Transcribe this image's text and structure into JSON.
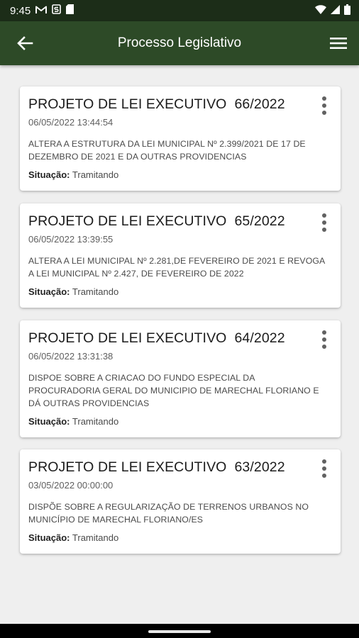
{
  "status_bar": {
    "time": "9:45",
    "icons": [
      "gmail-icon",
      "s-app-icon",
      "sd-card-icon",
      "wifi-icon",
      "signal-icon",
      "battery-icon"
    ]
  },
  "app_bar": {
    "title": "Processo Legislativo",
    "back_icon": "arrow-back-icon",
    "menu_icon": "hamburger-menu-icon",
    "background_color": "#2d4a27"
  },
  "cards": [
    {
      "title": "PROJETO DE LEI EXECUTIVO  66/2022",
      "date": "06/05/2022 13:44:54",
      "description": "ALTERA A ESTRUTURA DA LEI MUNICIPAL Nº 2.399/2021 DE 17 DE DEZEMBRO DE 2021 E DA OUTRAS PROVIDENCIAS",
      "status_label": "Situação:",
      "status_value": "Tramitando"
    },
    {
      "title": "PROJETO DE LEI EXECUTIVO  65/2022",
      "date": "06/05/2022 13:39:55",
      "description": "ALTERA A LEI MUNICIPAL Nº 2.281,DE FEVEREIRO DE 2021 E REVOGA A LEI MUNICIPAL Nº 2.427, DE FEVEREIRO DE 2022",
      "status_label": "Situação:",
      "status_value": "Tramitando"
    },
    {
      "title": "PROJETO DE LEI EXECUTIVO  64/2022",
      "date": "06/05/2022 13:31:38",
      "description": "DISPOE SOBRE A CRIACAO DO FUNDO ESPECIAL DA PROCURADORIA GERAL DO MUNICIPIO DE MARECHAL FLORIANO E DÁ OUTRAS PROVIDENCIAS",
      "status_label": "Situação:",
      "status_value": "Tramitando"
    },
    {
      "title": "PROJETO DE LEI EXECUTIVO  63/2022",
      "date": "03/05/2022 00:00:00",
      "description": "DISPÕE SOBRE A REGULARIZAÇÃO DE TERRENOS URBANOS NO MUNICÍPIO DE MARECHAL FLORIANO/ES",
      "status_label": "Situação:",
      "status_value": "Tramitando"
    }
  ]
}
